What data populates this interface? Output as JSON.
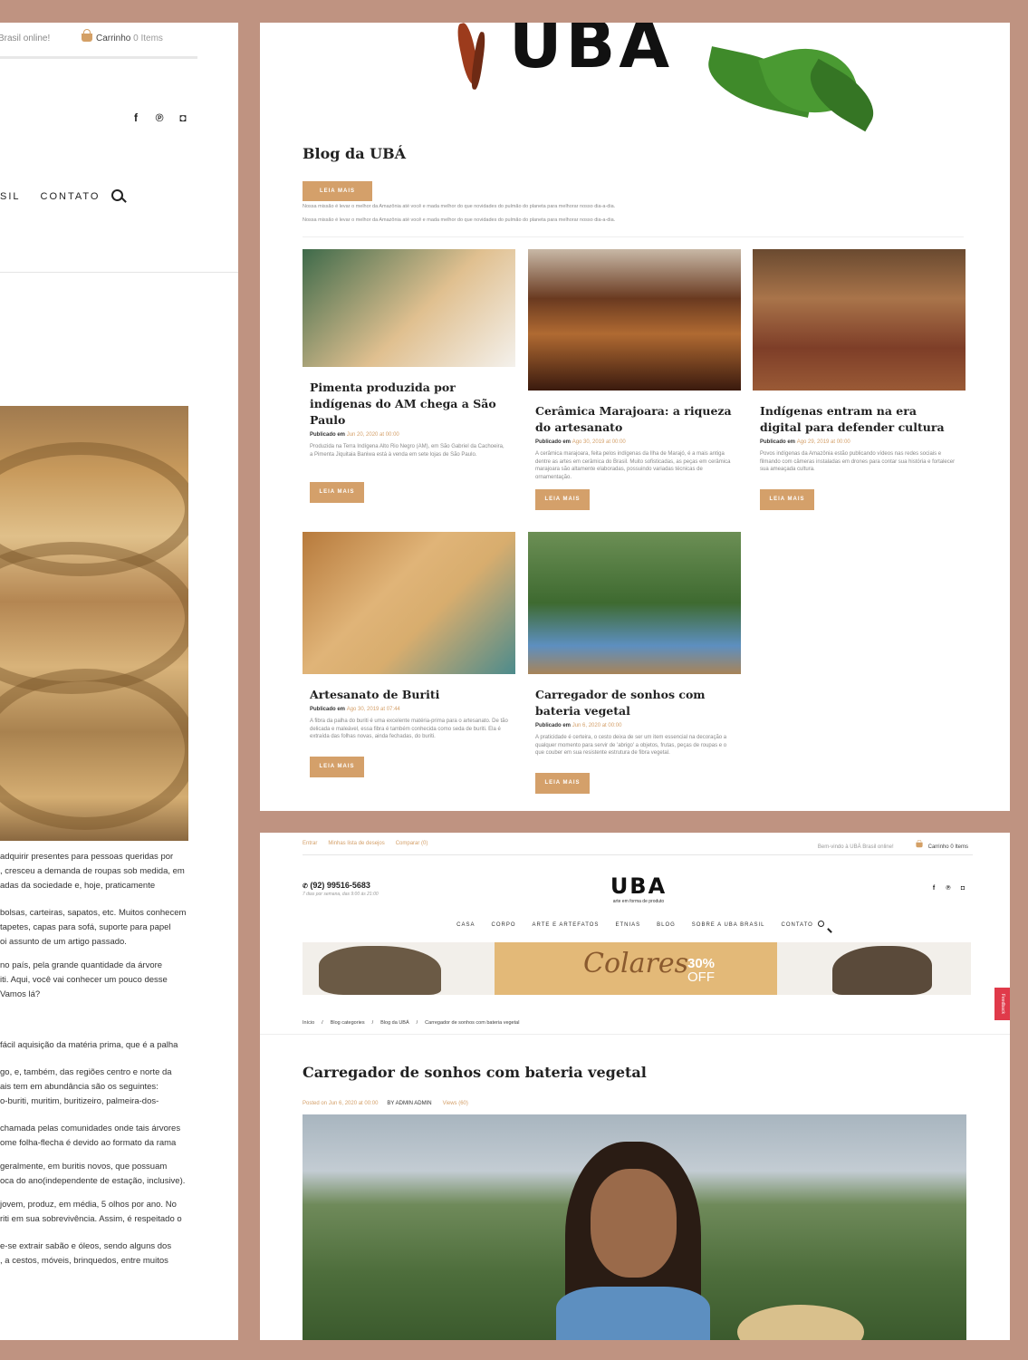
{
  "left_panel": {
    "welcome": "Brasil online!",
    "cart_label": "Carrinho",
    "cart_items": "0 Items",
    "nav": [
      "SIL",
      "CONTATO"
    ],
    "paragraphs": [
      [
        "adquirir presentes para pessoas queridas por",
        ", cresceu a demanda de roupas sob medida, em",
        "adas da sociedade e, hoje, praticamente"
      ],
      [
        "bolsas, carteiras, sapatos, etc. Muitos conhecem",
        "tapetes, capas para sofá, suporte para papel",
        "oi assunto de um artigo passado."
      ],
      [
        "no país, pela grande quantidade da árvore",
        "iti. Aqui, você vai conhecer um pouco desse",
        "Vamos lá?"
      ],
      [
        "fácil aquisição da matéria prima, que é a palha"
      ],
      [
        "go, e, também, das regiões centro e norte da",
        "ais tem em abundância são os seguintes:",
        "o-buriti, muritim, buritizeiro, palmeira-dos-"
      ],
      [
        "chamada pelas comunidades onde tais árvores",
        "ome folha-flecha é devido ao formato da rama"
      ],
      [
        "geralmente, em buritis novos, que possuam",
        "oca do ano(independente de estação, inclusive)."
      ],
      [
        "jovem, produz, em média, 5 olhos por ano. No",
        "riti em sua sobrevivência. Assim, é respeitado o"
      ],
      [
        "e-se extrair sabão e óleos, sendo alguns dos",
        ", a cestos, móveis, brinquedos, entre muitos"
      ]
    ]
  },
  "blog": {
    "logo_text": "UBA",
    "title": "Blog da UBÁ",
    "intro_button": "LEIA MAIS OCULTAR",
    "intro_lines": [
      "Nossa missão é levar o melhor da Amazônia até você e mada melhor do que novidades do pulmão do planeta para melhorar nosso dia-a-dia.",
      "Nossa missão é levar o melhor da Amazônia até você e mada melhor do que novidades do pulmão do planeta para melhorar nosso dia-a-dia."
    ],
    "published_label": "Publicado em",
    "read_more": "LEIA MAIS",
    "posts": [
      {
        "title": "Pimenta produzida por indígenas do AM chega a São Paulo",
        "date": "Jun 20, 2020 at 00:00",
        "excerpt": "Produzida na Terra Indígena Alto Rio Negro (AM), em São Gabriel da Cachoeira, a Pimenta Jiquitaia Baniwa está à venda em sete lojas de São Paulo."
      },
      {
        "title": "Cerâmica Marajoara: a riqueza do artesanato",
        "date": "Ago 30, 2019 at 00:00",
        "excerpt": "A cerâmica marajoara, feita pelos indígenas da Ilha de Marajó, é a mais antiga dentre as artes em cerâmica do Brasil. Muito sofisticadas, as peças em cerâmica marajoara são altamente elaboradas, possuindo variadas técnicas de ornamentação."
      },
      {
        "title": "Indígenas entram na era digital para defender cultura",
        "date": "Ago 29, 2019 at 00:00",
        "excerpt": "Povos indígenas da Amazônia estão publicando vídeos nas redes sociais e filmando com câmeras instaladas em drones para contar sua história e fortalecer sua ameaçada cultura."
      },
      {
        "title": "Artesanato de Buriti",
        "date": "Ago 30, 2019 at 07:44",
        "excerpt": "A fibra da palha do buriti é uma excelente matéria-prima para o artesanato. De tão delicada e maleável, essa fibra é também conhecida como seda de buriti. Ela é extraída das folhas novas, ainda fechadas, do buriti."
      },
      {
        "title": "Carregador de sonhos com bateria vegetal",
        "date": "Jun 6, 2020 at 00:00",
        "excerpt": "A praticidade é certeira, o cesto deixa de ser um item essencial na decoração a qualquer momento para servir de 'abrigo' a objetos, frutas, peças de roupas e o que couber em sua resistente estrutura de fibra vegetal."
      }
    ]
  },
  "post_page": {
    "top_links": [
      "Entrar",
      "Minhas lista de desejos",
      "Comparar (0)"
    ],
    "welcome": "Bem-vindo à UBÁ Brasil online!",
    "cart_label": "Carrinho",
    "cart_items": "0 Items",
    "phone": "(92) 99516-5683",
    "hours": "7 dias por semana, das 9:00 às 21:00",
    "logo_word": "UBA",
    "logo_tag": "arte em forma de produto",
    "nav": [
      "CASA",
      "CORPO",
      "ARTE E ARTEFATOS",
      "ETNIAS",
      "BLOG",
      "SOBRE A UBA BRASIL",
      "CONTATO"
    ],
    "banner_script": "Colares",
    "banner_percent": "30%",
    "banner_off": "OFF",
    "feedback": "Feedback",
    "breadcrumbs": [
      "Início",
      "/",
      "Blog categories",
      "/",
      "Blog da UBÁ",
      "/",
      "Carregador de sonhos com bateria vegetal"
    ],
    "title": "Carregador de sonhos com bateria vegetal",
    "posted": "Posted on Jun 6, 2020 at 00:00",
    "author": "BY ADMIN ADMIN",
    "views": "Views (60)"
  },
  "colors": {
    "background": "#bf9381",
    "accent": "#d4a06a",
    "feedback": "#e03a4a"
  },
  "icons": [
    "facebook-icon",
    "pinterest-icon",
    "instagram-icon",
    "search-icon",
    "cart-icon",
    "phone-icon"
  ]
}
